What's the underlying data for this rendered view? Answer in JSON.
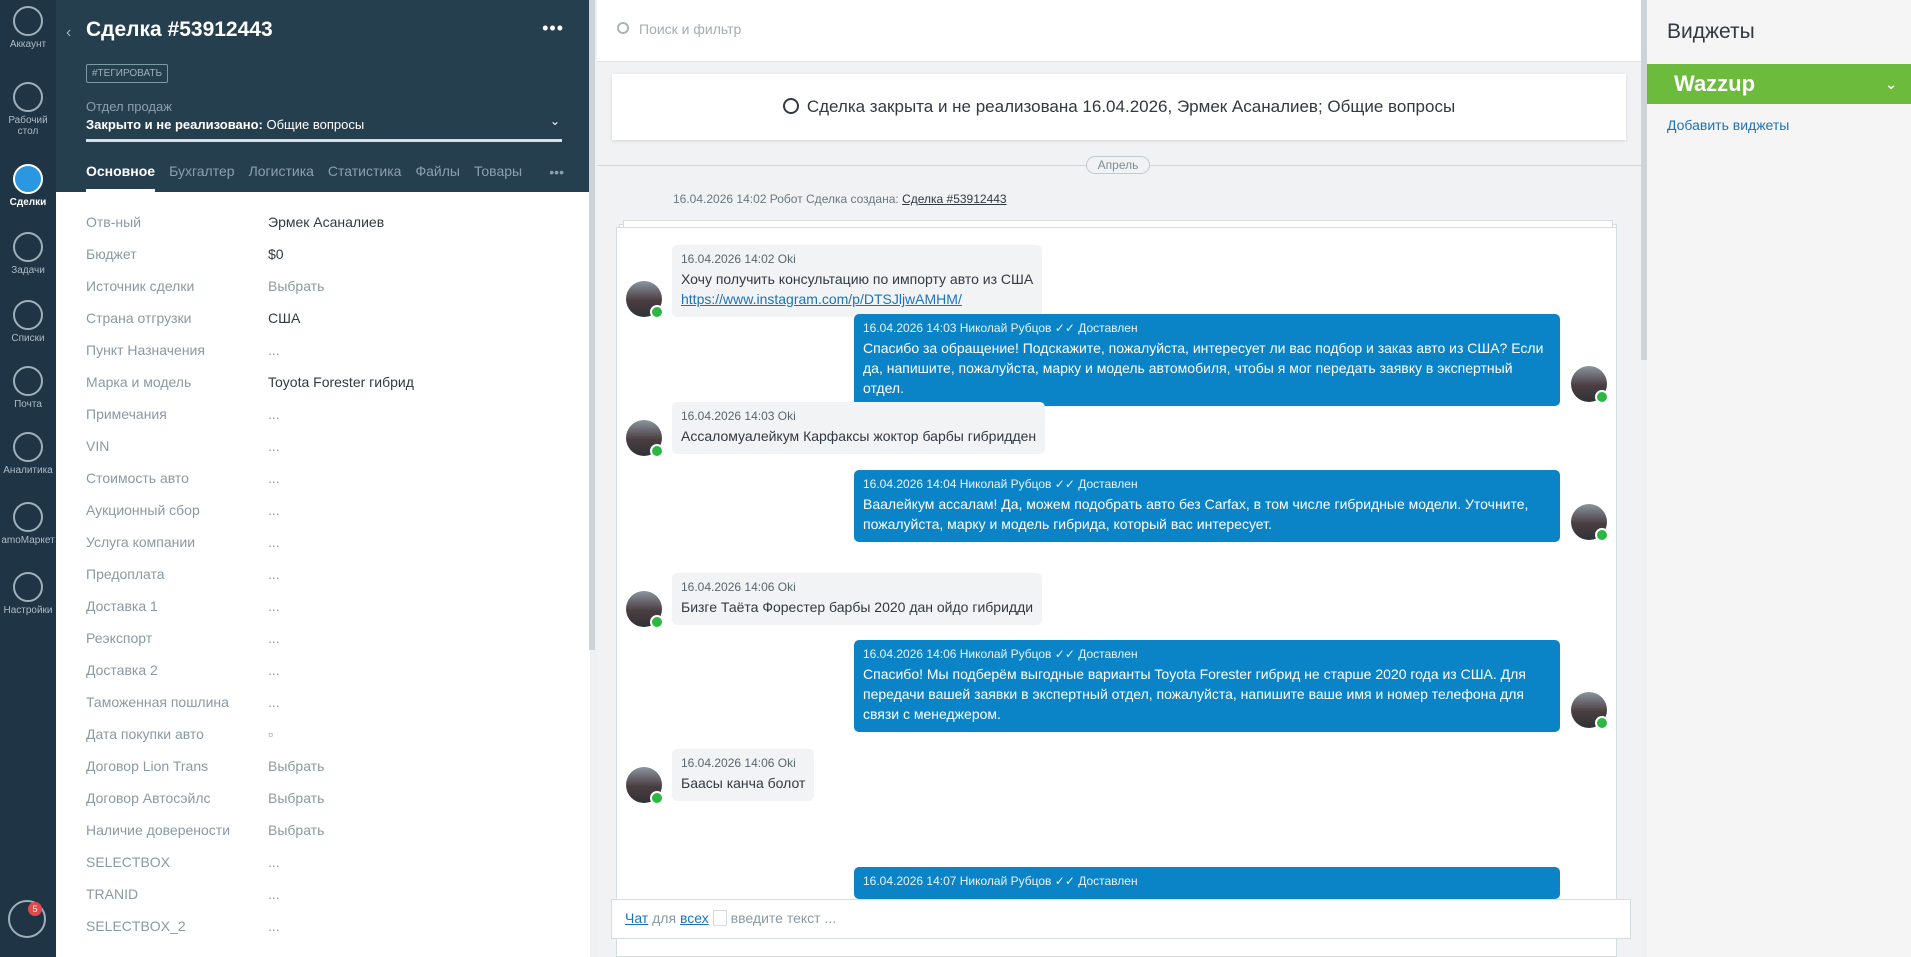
{
  "nav": {
    "items": [
      {
        "label": "Аккаунт",
        "icon": "account-icon"
      },
      {
        "label": "Рабочий стол",
        "icon": "dashboard-icon"
      },
      {
        "label": "Сделки",
        "icon": "deals-icon"
      },
      {
        "label": "Задачи",
        "icon": "tasks-icon"
      },
      {
        "label": "Списки",
        "icon": "lists-icon"
      },
      {
        "label": "Почта",
        "icon": "mail-icon"
      },
      {
        "label": "Аналитика",
        "icon": "analytics-icon"
      },
      {
        "label": "amoМаркет",
        "icon": "market-icon"
      },
      {
        "label": "Настройки",
        "icon": "settings-icon"
      }
    ],
    "notif_count": "5"
  },
  "deal": {
    "title": "Сделка #53912443",
    "tag_btn": "#ТЕГИРОВАТЬ",
    "pipeline_label": "Отдел продаж",
    "status_bold": "Закрыто и не реализовано:",
    "status_reason": " Общие вопросы",
    "tabs": [
      "Основное",
      "Бухгалтер",
      "Логистика",
      "Статистика",
      "Файлы",
      "Товары"
    ],
    "fields": [
      {
        "label": "Отв-ный",
        "value": "Эрмек Асаналиев"
      },
      {
        "label": "Бюджет",
        "value": "$0"
      },
      {
        "label": "Источник сделки",
        "value": "Выбрать"
      },
      {
        "label": "Страна отгрузки",
        "value": "США"
      },
      {
        "label": "Пункт Назначения",
        "value": "..."
      },
      {
        "label": "Марка и модель",
        "value": "Toyota Forester гибрид"
      },
      {
        "label": "Примечания",
        "value": "..."
      },
      {
        "label": "VIN",
        "value": "..."
      },
      {
        "label": "Стоимость авто",
        "value": "..."
      },
      {
        "label": "Аукционный сбор",
        "value": "..."
      },
      {
        "label": "Услуга компании",
        "value": "..."
      },
      {
        "label": "Предоплата",
        "value": "..."
      },
      {
        "label": "Доставка 1",
        "value": "..."
      },
      {
        "label": "Реэкспорт",
        "value": "..."
      },
      {
        "label": "Доставка 2",
        "value": "..."
      },
      {
        "label": "Таможенная пошлина",
        "value": "..."
      },
      {
        "label": "Дата покупки авто",
        "value": "▫"
      },
      {
        "label": "Договор Lion Trans",
        "value": "Выбрать"
      },
      {
        "label": "Договор Автосэйлс",
        "value": "Выбрать"
      },
      {
        "label": "Наличие доверености",
        "value": "Выбрать"
      },
      {
        "label": "SELECTBOX",
        "value": "..."
      },
      {
        "label": "TRANID",
        "value": "..."
      },
      {
        "label": "SELECTBOX_2",
        "value": "..."
      }
    ]
  },
  "feed": {
    "search_placeholder": "Поиск и фильтр",
    "closed_notice": "Сделка закрыта и не реализована 16.04.2026, Эрмек Асаналиев; Общие вопросы",
    "date_pill": "Апрель",
    "system_event": "16.04.2026 14:02 Робот Сделка создана:",
    "system_link": "Сделка #53912443",
    "messages": [
      {
        "dir": "in",
        "meta": "16.04.2026 14:02 Oki",
        "text": "Хочу получить консультацию по импорту авто из США",
        "link": "https://www.instagram.com/p/DTSJljwAMHM/"
      },
      {
        "dir": "out",
        "meta": "16.04.2026 14:03 Николай Рубцов ✓✓ Доставлен",
        "text": "Спасибо за обращение! Подскажите, пожалуйста, интересует ли вас подбор и заказ авто из США? Если да, напишите, пожалуйста, марку и модель автомобиля, чтобы я мог передать заявку в экспертный отдел."
      },
      {
        "dir": "in",
        "meta": "16.04.2026 14:03 Oki",
        "text": "Ассаломуалейкум Карфаксы жоктор барбы гибридден"
      },
      {
        "dir": "out",
        "meta": "16.04.2026 14:04 Николай Рубцов ✓✓ Доставлен",
        "text": "Ваалейкум ассалам! Да, можем подобрать авто без Carfax, в том числе гибридные модели. Уточните, пожалуйста, марку и модель гибрида, который вас интересует."
      },
      {
        "dir": "in",
        "meta": "16.04.2026 14:06 Oki",
        "text": "Бизге Таёта Форестер барбы 2020 дан ойдо гибридди"
      },
      {
        "dir": "out",
        "meta": "16.04.2026 14:06 Николай Рубцов ✓✓ Доставлен",
        "text": "Спасибо! Мы подберём выгодные варианты Toyota Forester гибрид не старше 2020 года из США. Для передачи вашей заявки в экспертный отдел, пожалуйста, напишите ваше имя и номер телефона для связи с менеджером."
      },
      {
        "dir": "in",
        "meta": "16.04.2026 14:06 Oki",
        "text": "Баасы канча болот"
      },
      {
        "dir": "out",
        "meta": "16.04.2026 14:07 Николай Рубцов ✓✓ Доставлен",
        "text": ""
      }
    ],
    "composer": {
      "chat": "Чат",
      "for": " для ",
      "all": "всех",
      "placeholder": "введите текст ..."
    }
  },
  "widgets": {
    "title": "Виджеты",
    "wazzup": "Wazzup",
    "add": "Добавить виджеты"
  }
}
